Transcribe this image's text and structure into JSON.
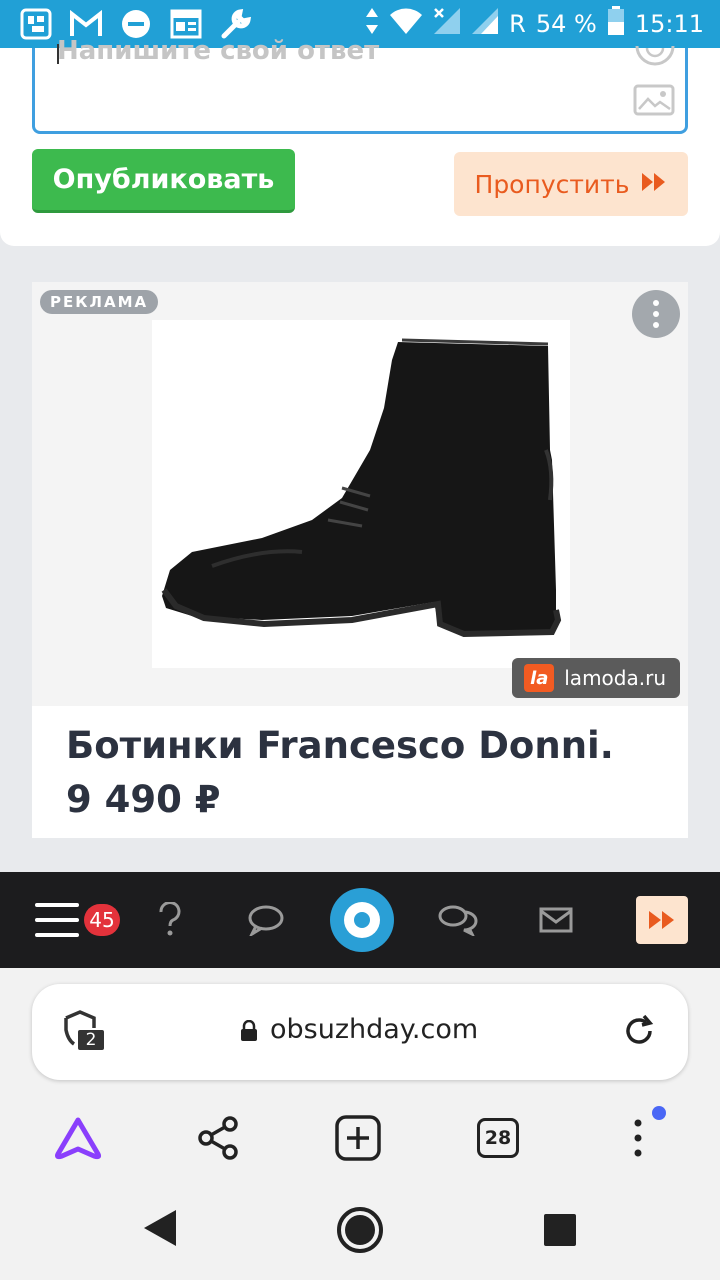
{
  "status_bar": {
    "network_type": "R",
    "battery_percent": "54 %",
    "time": "15:11",
    "icons": [
      "app-icon",
      "gmail-icon",
      "dnd-icon",
      "news-icon",
      "wrench-icon",
      "data-arrows-icon",
      "wifi-icon",
      "signal-x-icon",
      "signal-icon",
      "battery-icon"
    ]
  },
  "composer": {
    "placeholder": "Напишите свой ответ",
    "publish_label": "Опубликовать",
    "skip_label": "Пропустить"
  },
  "ad": {
    "badge": "РЕКЛАМА",
    "source_logo": "la",
    "source": "lamoda.ru",
    "title": "Ботинки Francesco Donni.",
    "price": "9 490 ₽"
  },
  "site_nav": {
    "notifications_count": "45",
    "items": [
      "menu-icon",
      "question-icon",
      "comment-icon",
      "home-logo-icon",
      "chats-icon",
      "mail-icon",
      "skip-icon"
    ]
  },
  "browser": {
    "protect_tabs_count": "2",
    "url": "obsuzhday.com",
    "tabs_count": "28"
  },
  "colors": {
    "status_bar": "#21a0d6",
    "publish_green": "#3dba4e",
    "skip_orange": "#e95b1f",
    "skip_bg": "#fde4cf",
    "nav_dark": "#1c1c1e",
    "accent_blue": "#2a9fd6",
    "alice_purple": "#8a3ffc"
  }
}
